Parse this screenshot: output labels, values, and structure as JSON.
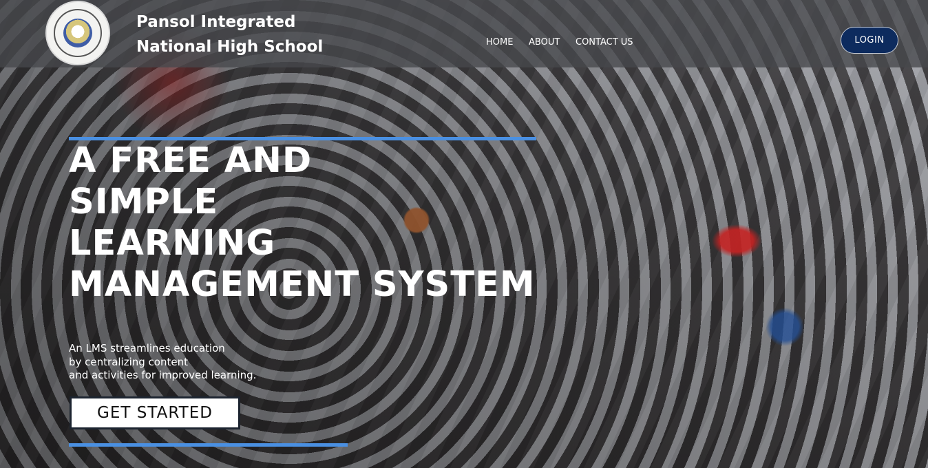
{
  "header": {
    "school_name_line1": "Pansol Integrated",
    "school_name_line2": "National High School",
    "logo_icon": "school-seal-icon",
    "nav": [
      {
        "label": "HOME"
      },
      {
        "label": "ABOUT"
      },
      {
        "label": "CONTACT US"
      }
    ],
    "login_label": "LOGIN"
  },
  "hero": {
    "title_lines": [
      "A FREE AND",
      "SIMPLE",
      "LEARNING",
      "MANAGEMENT SYSTEM"
    ],
    "subtitle_lines": [
      "An LMS streamlines education",
      "by centralizing content",
      "and activities for improved learning."
    ],
    "cta_label": "GET STARTED"
  },
  "colors": {
    "accent_line": "#4a90e2",
    "login_bg": "#0d2b5e",
    "header_overlay": "#46484c",
    "text": "#ffffff"
  }
}
